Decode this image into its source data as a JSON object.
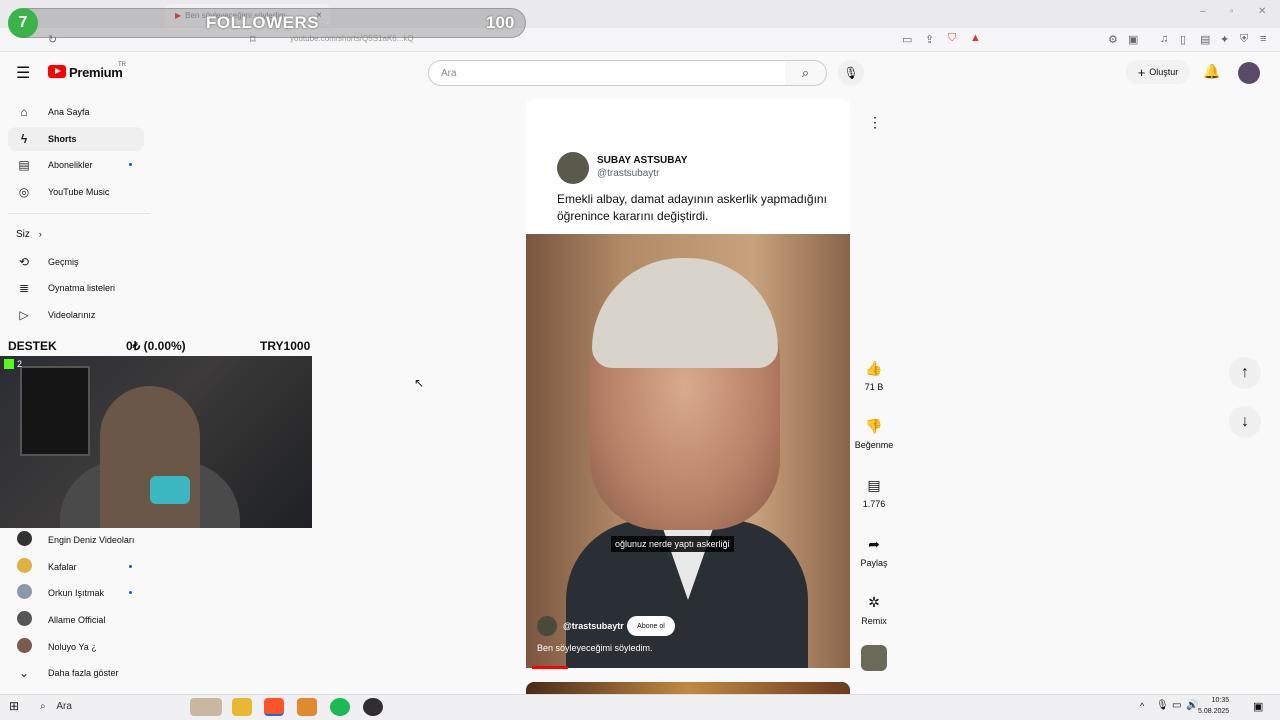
{
  "browser": {
    "tab_title": "Ben söyleyeceğimi söyledim.",
    "url": "youtube.com/shorts/Q5S1aK6...kQ"
  },
  "overlay": {
    "followers_goal_current": "7",
    "followers_label": "FOLLOWERS",
    "followers_goal_target": "100",
    "donation_label": "DESTEK",
    "donation_amount": "0₺ (0.00%)",
    "donation_goal": "TRY1000",
    "cam_viewers": "2"
  },
  "header": {
    "brand": "Premium",
    "region": "TR",
    "search_placeholder": "Ara",
    "create_label": "Oluştur"
  },
  "sidebar": {
    "main_items": [
      {
        "label": "Ana Sayfa",
        "icon": "home-icon"
      },
      {
        "label": "Shorts",
        "icon": "shorts-icon"
      },
      {
        "label": "Abonelikler",
        "icon": "subscriptions-icon"
      },
      {
        "label": "YouTube Music",
        "icon": "music-icon"
      }
    ],
    "you_section_label": "Siz",
    "you_items": [
      {
        "label": "Geçmiş",
        "icon": "history-icon"
      },
      {
        "label": "Oynatma listeleri",
        "icon": "playlist-icon"
      },
      {
        "label": "Videolarınız",
        "icon": "video-icon"
      }
    ],
    "subscriptions": [
      {
        "label": "Engin Deniz Videoları"
      },
      {
        "label": "Kafalar"
      },
      {
        "label": "Orkun Işıtmak"
      },
      {
        "label": "Allame Official"
      },
      {
        "label": "Noluyo Ya ¿"
      }
    ],
    "show_more_label": "Daha fazla göster"
  },
  "short": {
    "tweet_name": "SUBAY ASTSUBAY",
    "tweet_handle": "@trastsubaytr",
    "tweet_text": "Emekli albay, damat adayının askerlik yapmadığını öğrenince kararını değiştirdi.",
    "subtitle": "oğlunuz nerde yaptı askerliği",
    "channel_handle": "@trastsubaytr",
    "subscribe_label": "Abone ol",
    "video_title": "Ben söyleyeceğimi söyledim.",
    "progress": 0.11
  },
  "actions": {
    "like_count": "71 B",
    "dislike_label": "Beğenme",
    "comment_count": "1.776",
    "share_label": "Paylaş",
    "remix_label": "Remix"
  },
  "taskbar": {
    "search_label": "Ara",
    "time": "10:35",
    "date": "5.08.2025"
  }
}
